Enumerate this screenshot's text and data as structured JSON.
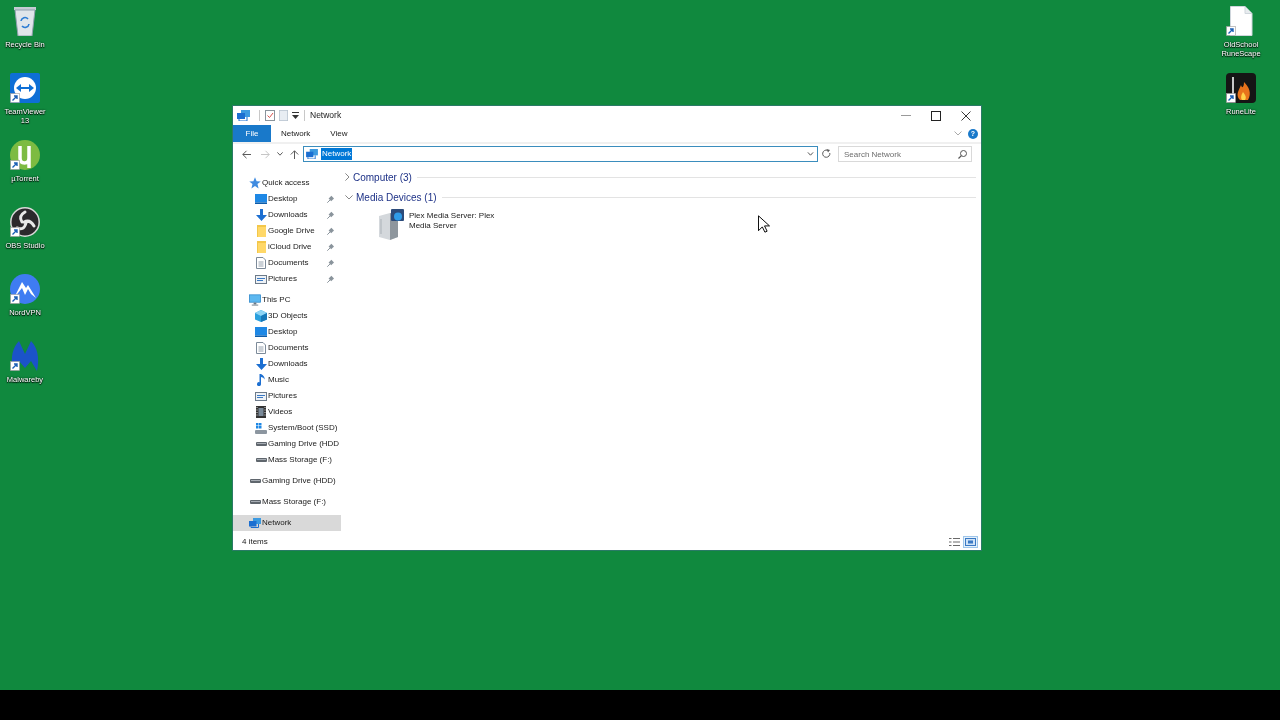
{
  "desktop": {
    "left_shortcuts": [
      {
        "label": "Recycle Bin",
        "kind": "recycle-bin",
        "shortcut": false
      },
      {
        "label": "TeamViewer 13",
        "kind": "arrows-tile",
        "shortcut": true
      },
      {
        "label": "µTorrent",
        "kind": "mu-circle",
        "shortcut": true
      },
      {
        "label": "OBS Studio",
        "kind": "swirl-circle",
        "shortcut": true
      },
      {
        "label": "NordVPN",
        "kind": "mountain-circle",
        "shortcut": true
      },
      {
        "label": "Malwareby",
        "kind": "m-logo",
        "shortcut": true
      }
    ],
    "right_shortcuts": [
      {
        "label": "OldSchool RuneScape",
        "kind": "blank-file",
        "shortcut": true
      },
      {
        "label": "RuneLite",
        "kind": "flame-tile",
        "shortcut": true
      }
    ]
  },
  "window": {
    "title": "Network",
    "ribbon": {
      "tabs": [
        {
          "label": "File",
          "kind": "file"
        },
        {
          "label": "Network",
          "kind": "tab"
        },
        {
          "label": "View",
          "kind": "tab"
        }
      ],
      "help_button": "?"
    },
    "address_bar": {
      "nav_buttons": [
        {
          "kind": "back",
          "disabled": false
        },
        {
          "kind": "forward",
          "disabled": true
        },
        {
          "kind": "recent",
          "disabled": false
        },
        {
          "kind": "up",
          "disabled": false
        }
      ],
      "location": {
        "value": "Network",
        "highlighted": true
      },
      "search": {
        "placeholder": "Search Network"
      }
    },
    "navigation_pane": {
      "items": [
        {
          "label": "Quick access",
          "kind": "star",
          "selected": false,
          "children": [
            {
              "label": "Desktop",
              "kind": "desktop",
              "pinned": true,
              "selected": false
            },
            {
              "label": "Downloads",
              "kind": "downloads",
              "pinned": true,
              "selected": false
            },
            {
              "label": "Google Drive",
              "kind": "folder",
              "pinned": true,
              "selected": false
            },
            {
              "label": "iCloud Drive",
              "kind": "folder",
              "pinned": true,
              "selected": false
            },
            {
              "label": "Documents",
              "kind": "documents",
              "pinned": true,
              "selected": false
            },
            {
              "label": "Pictures",
              "kind": "pictures",
              "pinned": true,
              "selected": false
            }
          ]
        },
        {
          "label": "This PC",
          "kind": "pc",
          "selected": false,
          "children": [
            {
              "label": "3D Objects",
              "kind": "objects3d",
              "selected": false
            },
            {
              "label": "Desktop",
              "kind": "desktop",
              "selected": false
            },
            {
              "label": "Documents",
              "kind": "documents",
              "selected": false
            },
            {
              "label": "Downloads",
              "kind": "downloads",
              "selected": false
            },
            {
              "label": "Music",
              "kind": "music",
              "selected": false
            },
            {
              "label": "Pictures",
              "kind": "pictures",
              "selected": false
            },
            {
              "label": "Videos",
              "kind": "videos",
              "selected": false
            },
            {
              "label": "System/Boot (SSD)",
              "kind": "system-drive",
              "selected": false
            },
            {
              "label": "Gaming Drive (HDD",
              "kind": "drive",
              "selected": false
            },
            {
              "label": "Mass Storage (F:)",
              "kind": "drive",
              "selected": false
            }
          ]
        },
        {
          "label": "Gaming Drive (HDD)",
          "kind": "drive",
          "selected": false
        },
        {
          "label": "Mass Storage (F:)",
          "kind": "drive",
          "selected": false
        },
        {
          "label": "Network",
          "kind": "network",
          "selected": true
        }
      ]
    },
    "content": {
      "groups": [
        {
          "title": "Computer (3)",
          "expanded": false
        },
        {
          "title": "Media Devices (1)",
          "expanded": true,
          "items": [
            {
              "label": "Plex Media Server: Plex Media Server"
            }
          ]
        }
      ]
    },
    "status_bar": {
      "item_count": "4 items",
      "view_buttons": [
        {
          "kind": "details",
          "selected": false
        },
        {
          "kind": "large-icons",
          "selected": true
        }
      ]
    }
  }
}
